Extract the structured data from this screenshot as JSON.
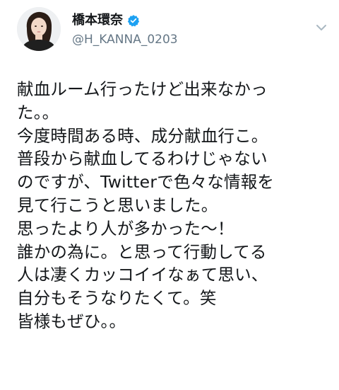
{
  "tweet": {
    "author": {
      "display_name": "橋本環奈",
      "username": "@H_KANNA_0203",
      "verified_icon": "verified-badge-icon",
      "menu_icon": "chevron-down-icon"
    },
    "lines": [
      "献血ルーム行ったけど出来なかっ",
      "た。。",
      "今度時間ある時、成分献血行こ。",
      "普段から献血してるわけじゃない",
      "のですが、Twitterで色々な情報を",
      "見て行こうと思いました。",
      "思ったより人が多かった〜！",
      "誰かの為に。と思って行動してる",
      "人は凄くカッコイイなぁて思い、",
      "自分もそうなりたくて。笑",
      "皆様もぜひ。。"
    ]
  },
  "colors": {
    "text": "#14171a",
    "secondary_text": "#657786",
    "verified_blue": "#1da1f2",
    "chevron_gray": "#aab8c2"
  }
}
